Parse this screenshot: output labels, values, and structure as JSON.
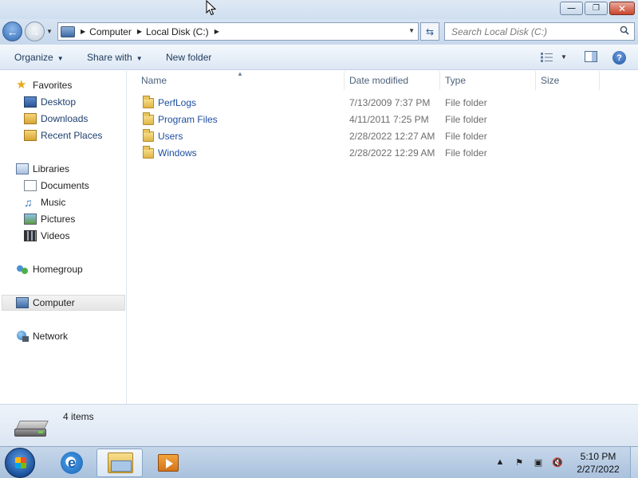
{
  "window": {
    "minimize_glyph": "—",
    "restore_glyph": "❐",
    "close_glyph": "✕"
  },
  "address": {
    "crumbs": [
      "Computer",
      "Local Disk (C:)"
    ],
    "search_placeholder": "Search Local Disk (C:)"
  },
  "toolbar": {
    "organize_label": "Organize",
    "share_label": "Share with",
    "new_folder_label": "New folder",
    "help_glyph": "?"
  },
  "nav": {
    "favorites": "Favorites",
    "desktop": "Desktop",
    "downloads": "Downloads",
    "recent": "Recent Places",
    "libraries": "Libraries",
    "documents": "Documents",
    "music": "Music",
    "pictures": "Pictures",
    "videos": "Videos",
    "homegroup": "Homegroup",
    "computer": "Computer",
    "network": "Network"
  },
  "columns": {
    "name": "Name",
    "date": "Date modified",
    "type": "Type",
    "size": "Size"
  },
  "files": [
    {
      "name": "PerfLogs",
      "date": "7/13/2009 7:37 PM",
      "type": "File folder"
    },
    {
      "name": "Program Files",
      "date": "4/11/2011 7:25 PM",
      "type": "File folder"
    },
    {
      "name": "Users",
      "date": "2/28/2022 12:27 AM",
      "type": "File folder"
    },
    {
      "name": "Windows",
      "date": "2/28/2022 12:29 AM",
      "type": "File folder"
    }
  ],
  "details": {
    "item_count": "4 items"
  },
  "taskbar": {
    "time": "5:10 PM",
    "date": "2/27/2022"
  },
  "icons": {
    "folder": "folder-icon",
    "search": "search-icon",
    "back": "back-arrow-icon",
    "forward": "forward-arrow-icon"
  }
}
